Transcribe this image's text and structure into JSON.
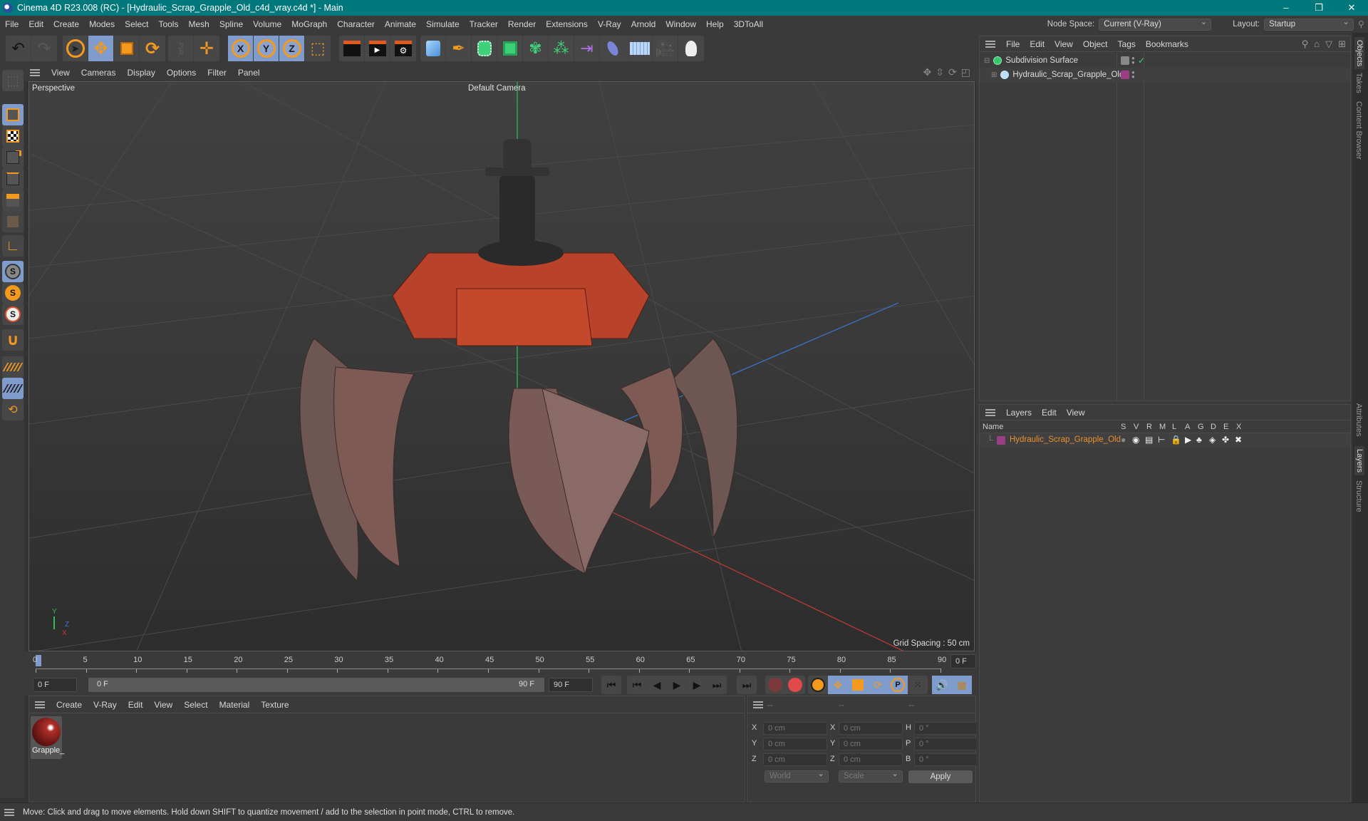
{
  "window": {
    "title": "Cinema 4D R23.008 (RC) - [Hydraulic_Scrap_Grapple_Old_c4d_vray.c4d *] - Main",
    "controls": [
      "–",
      "❐",
      "✕"
    ]
  },
  "menubar": {
    "items": [
      "File",
      "Edit",
      "Create",
      "Modes",
      "Select",
      "Tools",
      "Mesh",
      "Spline",
      "Volume",
      "MoGraph",
      "Character",
      "Animate",
      "Simulate",
      "Tracker",
      "Render",
      "Extensions",
      "V-Ray",
      "Arnold",
      "Window",
      "Help",
      "3DToAll"
    ],
    "node_space_label": "Node Space:",
    "node_space_value": "Current (V-Ray)",
    "layout_label": "Layout:",
    "layout_value": "Startup"
  },
  "toolbar": {
    "axis_x": "X",
    "axis_y": "Y",
    "axis_z": "Z",
    "psr": "PSR"
  },
  "viewport": {
    "menu": [
      "View",
      "Cameras",
      "Display",
      "Options",
      "Filter",
      "Panel"
    ],
    "view_name": "Perspective",
    "camera": "Default Camera",
    "grid_spacing": "Grid Spacing : 50 cm",
    "axis_labels": {
      "y": "Y",
      "z": "Z",
      "x": "X"
    }
  },
  "timeline": {
    "ticks": [
      "0",
      "5",
      "10",
      "15",
      "20",
      "25",
      "30",
      "35",
      "40",
      "45",
      "50",
      "55",
      "60",
      "65",
      "70",
      "75",
      "80",
      "85",
      "90"
    ],
    "current_frame": "0 F",
    "start_field": "0 F",
    "range_start": "0 F",
    "range_end": "90 F",
    "end_field": "90 F"
  },
  "materials": {
    "menu": [
      "Create",
      "V-Ray",
      "Edit",
      "View",
      "Select",
      "Material",
      "Texture"
    ],
    "items": [
      {
        "name": "Grapple_"
      }
    ]
  },
  "coordinates": {
    "headers": [
      "--",
      "--",
      "--"
    ],
    "rows": [
      {
        "l1": "X",
        "v1": "0 cm",
        "l2": "X",
        "v2": "0 cm",
        "l3": "H",
        "v3": "0 °"
      },
      {
        "l1": "Y",
        "v1": "0 cm",
        "l2": "Y",
        "v2": "0 cm",
        "l3": "P",
        "v3": "0 °"
      },
      {
        "l1": "Z",
        "v1": "0 cm",
        "l2": "Z",
        "v2": "0 cm",
        "l3": "B",
        "v3": "0 °"
      }
    ],
    "space": "World",
    "mode": "Scale",
    "apply": "Apply"
  },
  "object_manager": {
    "menu": [
      "File",
      "Edit",
      "View",
      "Object",
      "Tags",
      "Bookmarks"
    ],
    "objects": [
      {
        "name": "Subdivision Surface",
        "color": "#37c76b"
      },
      {
        "name": "Hydraulic_Scrap_Grapple_Old",
        "layer_color": "#9a3f86"
      }
    ]
  },
  "layer_manager": {
    "menu": [
      "Layers",
      "Edit",
      "View"
    ],
    "columns": [
      "Name",
      "S",
      "V",
      "R",
      "M",
      "L",
      "A",
      "G",
      "D",
      "E",
      "X"
    ],
    "layers": [
      {
        "name": "Hydraulic_Scrap_Grapple_Old",
        "color": "#9a3f86",
        "text_color": "#e8902e"
      }
    ]
  },
  "side_tabs": {
    "top": [
      "Objects",
      "Takes",
      "Content Browser"
    ],
    "bottom": [
      "Attributes",
      "Layers",
      "Structure"
    ]
  },
  "status": {
    "text": "Move: Click and drag to move elements. Hold down SHIFT to quantize movement / add to the selection in point mode, CTRL to remove."
  },
  "colors": {
    "accent_orange": "#f39a1e",
    "active_blue": "#7f9ccc",
    "title_teal": "#00787c"
  }
}
